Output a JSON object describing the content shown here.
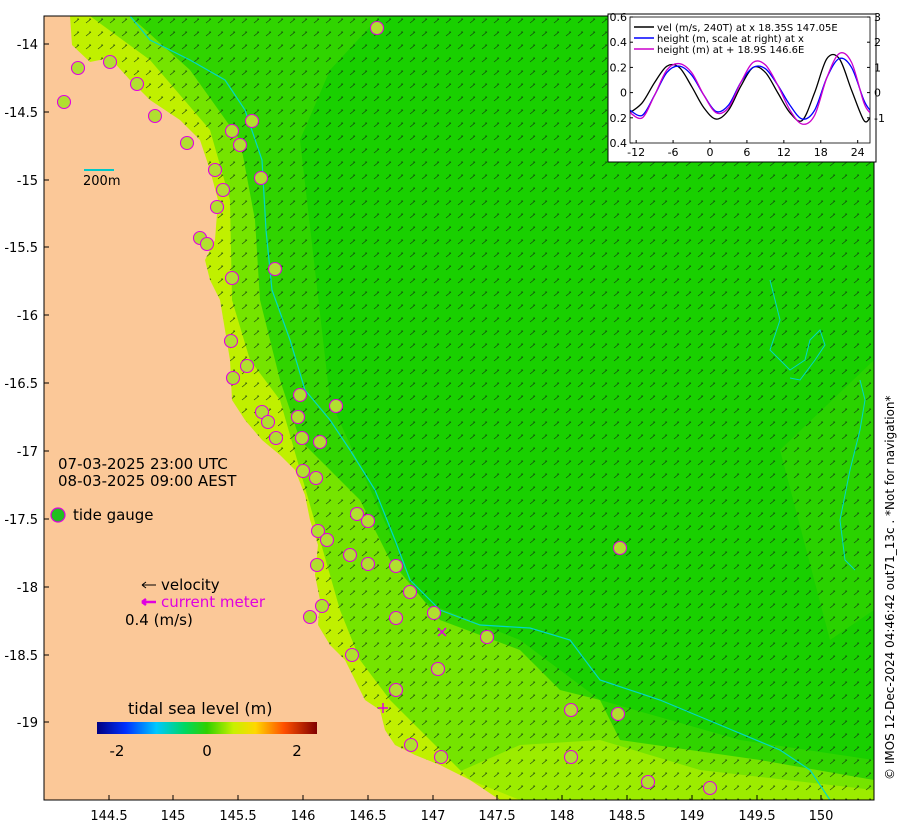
{
  "map": {
    "x_ticks": [
      "144.5",
      "145",
      "145.5",
      "146",
      "146.5",
      "147",
      "147.5",
      "148",
      "148.5",
      "149",
      "149.5",
      "150"
    ],
    "y_ticks": [
      "-14",
      "-14.5",
      "-15",
      "-15.5",
      "-16",
      "-16.5",
      "-17",
      "-17.5",
      "-18",
      "-18.5",
      "-19"
    ],
    "scale_bar_label": "200m",
    "time_utc": "07-03-2025 23:00 UTC",
    "time_local": "08-03-2025 09:00 AEST",
    "legend": {
      "tide_gauge": "tide gauge",
      "velocity": "velocity",
      "current_meter": "current meter",
      "velocity_scale": "0.4 (m/s)"
    },
    "colorbar": {
      "title": "tidal sea level (m)",
      "ticks": [
        "-2",
        "0",
        "2"
      ]
    },
    "credit": "© IMOS 12-Dec-2024 04:46:42 out71_13c . *Not for navigation*",
    "colors": {
      "land": "#fbc898",
      "sea_deep": "#19d000",
      "sea_mid": "#3dd800",
      "sea_shelf": "#75e400",
      "contour": "#00d8c8",
      "gauge_ring": "#e000e0",
      "current_meter": "#e000e0"
    }
  },
  "chart_data": {
    "type": "line",
    "x_ticks": [
      "-12",
      "-6",
      "0",
      "6",
      "12",
      "18",
      "24"
    ],
    "y_left_ticks": [
      "0.6",
      "0.4",
      "0.2",
      "0",
      "0.2",
      "0.4"
    ],
    "y_right_ticks": [
      "3",
      "2",
      "1",
      "0",
      "-1"
    ],
    "xlim": [
      -13,
      26
    ],
    "ylim": [
      -0.4,
      0.6
    ],
    "ylim_right": [
      -2,
      3
    ],
    "series": [
      {
        "name": "vel (m/s, 240T) at x 18.35S 147.05E",
        "color": "#000000",
        "axis": "left",
        "x": [
          -13,
          -11,
          -9,
          -7,
          -5,
          -3,
          -1,
          1,
          3,
          5,
          7,
          9,
          11,
          13,
          15,
          17,
          19,
          21,
          23,
          25,
          26
        ],
        "y": [
          -0.16,
          -0.08,
          0.08,
          0.21,
          0.2,
          0.05,
          -0.12,
          -0.21,
          -0.14,
          0.05,
          0.2,
          0.16,
          0.0,
          -0.16,
          -0.22,
          0.0,
          0.27,
          0.27,
          0.02,
          -0.22,
          -0.2
        ]
      },
      {
        "name": "height (m, scale at right) at x",
        "color": "#0000ff",
        "axis": "right",
        "x": [
          -13,
          -11,
          -9,
          -7,
          -5,
          -3,
          -1,
          1,
          3,
          5,
          7,
          9,
          11,
          13,
          15,
          17,
          19,
          21,
          23,
          25,
          26
        ],
        "y": [
          -0.7,
          -0.9,
          -0.1,
          0.8,
          1.05,
          0.7,
          -0.1,
          -0.75,
          -0.5,
          0.4,
          1.0,
          0.95,
          0.3,
          -0.5,
          -1.05,
          -0.7,
          0.6,
          1.35,
          1.0,
          -0.3,
          -0.7
        ]
      },
      {
        "name": "height (m) at + 18.9S 146.6E",
        "color": "#cc00cc",
        "axis": "right",
        "x": [
          -13,
          -11,
          -9,
          -7,
          -5,
          -3,
          -1,
          1,
          3,
          5,
          7,
          9,
          11,
          13,
          15,
          17,
          19,
          21,
          23,
          25,
          26
        ],
        "y": [
          -0.8,
          -1.0,
          -0.1,
          0.9,
          1.15,
          0.8,
          -0.1,
          -0.8,
          -0.6,
          0.4,
          1.2,
          1.1,
          0.3,
          -0.7,
          -1.25,
          -0.9,
          0.6,
          1.55,
          1.2,
          -0.4,
          -0.8
        ]
      }
    ]
  }
}
